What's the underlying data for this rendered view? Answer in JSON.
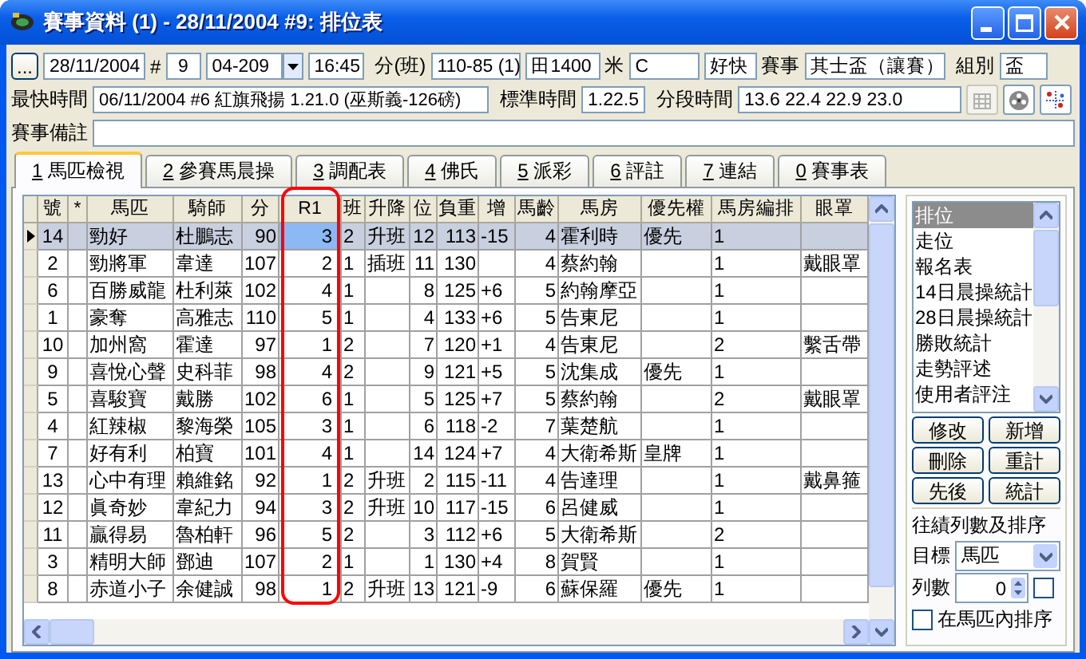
{
  "window": {
    "title": "賽事資料 (1) - 28/11/2004 #9: 排位表"
  },
  "header": {
    "browse": "...",
    "date": "28/11/2004",
    "number_label": "#",
    "number": "9",
    "code": "04-209",
    "time": "16:45",
    "class_label": "分(班)",
    "class": "110-85 (1)",
    "distance": "田1400",
    "distance_unit": "米",
    "course": "C",
    "going": "好快",
    "race_label": "賽事",
    "race": "其士盃（讓賽）",
    "group_label": "組別",
    "group": "盃",
    "best_time_label": "最快時間",
    "best_time": "06/11/2004 #6 紅旗飛揚 1.21.0 (巫斯義-126磅)",
    "standard_label": "標準時間",
    "standard": "1.22.5",
    "sectional_label": "分段時間",
    "sectional": "13.6  22.4  22.9  23.0",
    "remarks_label": "賽事備註"
  },
  "toolbar_icons": [
    {
      "kind": "grid",
      "disabled": true
    },
    {
      "kind": "reel",
      "disabled": false
    },
    {
      "kind": "chart",
      "disabled": false
    }
  ],
  "tabs": [
    {
      "key": "1",
      "label": "馬匹檢視",
      "selected": true
    },
    {
      "key": "2",
      "label": "參賽馬晨操",
      "selected": false
    },
    {
      "key": "3",
      "label": "調配表",
      "selected": false
    },
    {
      "key": "4",
      "label": "佛氏",
      "selected": false
    },
    {
      "key": "5",
      "label": "派彩",
      "selected": false
    },
    {
      "key": "6",
      "label": "評註",
      "selected": false
    },
    {
      "key": "7",
      "label": "連結",
      "selected": false
    },
    {
      "key": "0",
      "label": "賽事表",
      "selected": false
    }
  ],
  "table": {
    "columns": [
      "號",
      "*",
      "馬匹",
      "騎師",
      "分",
      "R1",
      "班",
      "升降",
      "位",
      "負重",
      "增",
      "馬齡",
      "馬房",
      "優先權",
      "馬房編排",
      "眼罩"
    ],
    "rows": [
      {
        "selected": true,
        "cells": [
          "14",
          "",
          "勁好",
          "杜鵬志",
          "90",
          "3",
          "2",
          "升班",
          "12",
          "113",
          "-15",
          "4",
          "霍利時",
          "優先",
          "1",
          ""
        ]
      },
      {
        "selected": false,
        "cells": [
          "2",
          "",
          "勁將軍",
          "韋達",
          "107",
          "2",
          "1",
          "插班",
          "11",
          "130",
          "",
          "4",
          "蔡約翰",
          "",
          "1",
          "戴眼罩"
        ]
      },
      {
        "selected": false,
        "cells": [
          "6",
          "",
          "百勝威龍",
          "杜利萊",
          "102",
          "4",
          "1",
          "",
          "8",
          "125",
          "+6",
          "5",
          "約翰摩亞",
          "",
          "1",
          ""
        ]
      },
      {
        "selected": false,
        "cells": [
          "1",
          "",
          "豪奪",
          "高雅志",
          "110",
          "5",
          "1",
          "",
          "4",
          "133",
          "+6",
          "5",
          "告東尼",
          "",
          "1",
          ""
        ]
      },
      {
        "selected": false,
        "cells": [
          "10",
          "",
          "加州窩",
          "霍達",
          "97",
          "1",
          "2",
          "",
          "7",
          "120",
          "+1",
          "4",
          "告東尼",
          "",
          "2",
          "繫舌帶"
        ]
      },
      {
        "selected": false,
        "cells": [
          "9",
          "",
          "喜悅心聲",
          "史科菲",
          "98",
          "4",
          "2",
          "",
          "9",
          "121",
          "+5",
          "5",
          "沈集成",
          "優先",
          "1",
          ""
        ]
      },
      {
        "selected": false,
        "cells": [
          "5",
          "",
          "喜駿寶",
          "戴勝",
          "102",
          "6",
          "1",
          "",
          "5",
          "125",
          "+7",
          "5",
          "蔡約翰",
          "",
          "2",
          "戴眼罩"
        ]
      },
      {
        "selected": false,
        "cells": [
          "4",
          "",
          "紅辣椒",
          "黎海榮",
          "105",
          "3",
          "1",
          "",
          "6",
          "118",
          "-2",
          "7",
          "葉楚航",
          "",
          "1",
          ""
        ]
      },
      {
        "selected": false,
        "cells": [
          "7",
          "",
          "好有利",
          "柏寶",
          "101",
          "4",
          "1",
          "",
          "14",
          "124",
          "+7",
          "4",
          "大衛希斯",
          "皇牌",
          "1",
          ""
        ]
      },
      {
        "selected": false,
        "cells": [
          "13",
          "",
          "心中有理",
          "賴維銘",
          "92",
          "1",
          "2",
          "升班",
          "2",
          "115",
          "-11",
          "4",
          "告達理",
          "",
          "1",
          "戴鼻箍"
        ]
      },
      {
        "selected": false,
        "cells": [
          "12",
          "",
          "眞奇妙",
          "韋紀力",
          "94",
          "3",
          "2",
          "升班",
          "10",
          "117",
          "-15",
          "6",
          "呂健威",
          "",
          "1",
          ""
        ]
      },
      {
        "selected": false,
        "cells": [
          "11",
          "",
          "贏得易",
          "魯柏軒",
          "96",
          "5",
          "2",
          "",
          "3",
          "112",
          "+6",
          "5",
          "大衛希斯",
          "",
          "2",
          ""
        ]
      },
      {
        "selected": false,
        "cells": [
          "3",
          "",
          "精明大師",
          "鄧迪",
          "107",
          "2",
          "1",
          "",
          "1",
          "130",
          "+4",
          "8",
          "賀賢",
          "",
          "1",
          ""
        ]
      },
      {
        "selected": false,
        "cells": [
          "8",
          "",
          "赤道小子",
          "余健誠",
          "98",
          "1",
          "2",
          "升班",
          "13",
          "121",
          "-9",
          "6",
          "蘇保羅",
          "優先",
          "1",
          ""
        ]
      }
    ]
  },
  "side_list": {
    "items": [
      {
        "label": "排位",
        "selected": true
      },
      {
        "label": "走位",
        "selected": false
      },
      {
        "label": "報名表",
        "selected": false
      },
      {
        "label": "14日晨操統計",
        "selected": false
      },
      {
        "label": "28日晨操統計",
        "selected": false
      },
      {
        "label": "勝敗統計",
        "selected": false
      },
      {
        "label": "走勢評述",
        "selected": false
      },
      {
        "label": "使用者評注",
        "selected": false
      }
    ]
  },
  "buttons": [
    "修改",
    "新增",
    "刪除",
    "重計",
    "先後",
    "統計"
  ],
  "history": {
    "title": "往績列數及排序",
    "target_label": "目標",
    "target": "馬匹",
    "rows_label": "列數",
    "rows": "0",
    "extra_checked": false,
    "sort_label": "在馬匹內排序",
    "sort_checked": false
  }
}
